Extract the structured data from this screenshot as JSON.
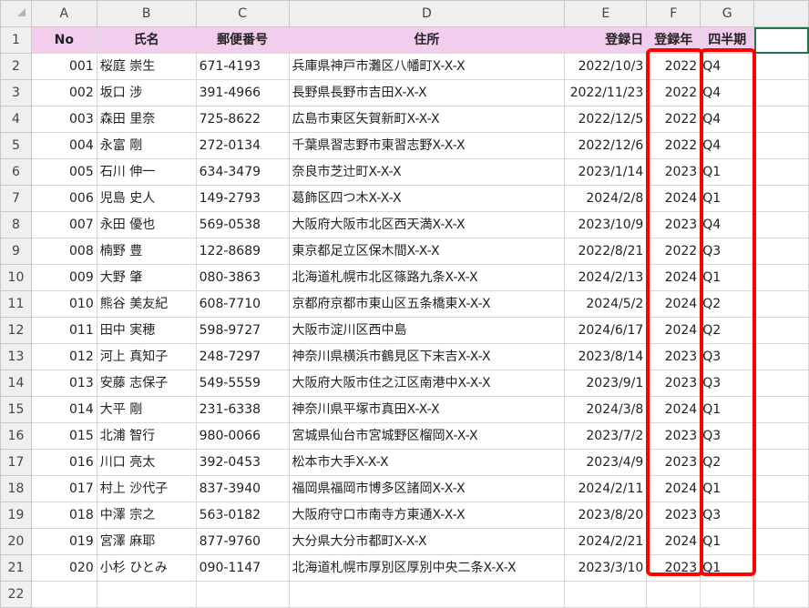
{
  "columns": [
    "A",
    "B",
    "C",
    "D",
    "E",
    "F",
    "G",
    ""
  ],
  "header": {
    "row_label": "1",
    "cells": [
      "No",
      "氏名",
      "郵便番号",
      "住所",
      "登録日",
      "登録年",
      "四半期",
      ""
    ]
  },
  "rows": [
    {
      "r": "2",
      "no": "001",
      "name": "桜庭 崇生",
      "zip": "671-4193",
      "addr": "兵庫県神戸市灘区八幡町X-X-X",
      "date": "2022/10/3",
      "year": "2022",
      "q": "Q4"
    },
    {
      "r": "3",
      "no": "002",
      "name": "坂口 涉",
      "zip": "391-4966",
      "addr": "長野県長野市吉田X-X-X",
      "date": "2022/11/23",
      "year": "2022",
      "q": "Q4"
    },
    {
      "r": "4",
      "no": "003",
      "name": "森田 里奈",
      "zip": "725-8622",
      "addr": "広島市東区矢賀新町X-X-X",
      "date": "2022/12/5",
      "year": "2022",
      "q": "Q4"
    },
    {
      "r": "5",
      "no": "004",
      "name": "永富 剛",
      "zip": "272-0134",
      "addr": "千葉県習志野市東習志野X-X-X",
      "date": "2022/12/6",
      "year": "2022",
      "q": "Q4"
    },
    {
      "r": "6",
      "no": "005",
      "name": "石川 伸一",
      "zip": "634-3479",
      "addr": "奈良市芝辻町X-X-X",
      "date": "2023/1/14",
      "year": "2023",
      "q": "Q1"
    },
    {
      "r": "7",
      "no": "006",
      "name": "児島 史人",
      "zip": "149-2793",
      "addr": "葛飾区四つ木X-X-X",
      "date": "2024/2/8",
      "year": "2024",
      "q": "Q1"
    },
    {
      "r": "8",
      "no": "007",
      "name": "永田 優也",
      "zip": "569-0538",
      "addr": "大阪府大阪市北区西天満X-X-X",
      "date": "2023/10/9",
      "year": "2023",
      "q": "Q4"
    },
    {
      "r": "9",
      "no": "008",
      "name": "楠野 豊",
      "zip": "122-8689",
      "addr": "東京都足立区保木間X-X-X",
      "date": "2022/8/21",
      "year": "2022",
      "q": "Q3"
    },
    {
      "r": "10",
      "no": "009",
      "name": "大野 肇",
      "zip": "080-3863",
      "addr": "北海道札幌市北区篠路九条X-X-X",
      "date": "2024/2/13",
      "year": "2024",
      "q": "Q1"
    },
    {
      "r": "11",
      "no": "010",
      "name": "熊谷 美友紀",
      "zip": "608-7710",
      "addr": "京都府京都市東山区五条橋東X-X-X",
      "date": "2024/5/2",
      "year": "2024",
      "q": "Q2"
    },
    {
      "r": "12",
      "no": "011",
      "name": "田中 実穂",
      "zip": "598-9727",
      "addr": "大阪市淀川区西中島",
      "date": "2024/6/17",
      "year": "2024",
      "q": "Q2"
    },
    {
      "r": "13",
      "no": "012",
      "name": "河上 真知子",
      "zip": "248-7297",
      "addr": "神奈川県横浜市鶴見区下末吉X-X-X",
      "date": "2023/8/14",
      "year": "2023",
      "q": "Q3"
    },
    {
      "r": "14",
      "no": "013",
      "name": "安藤 志保子",
      "zip": "549-5559",
      "addr": "大阪府大阪市住之江区南港中X-X-X",
      "date": "2023/9/1",
      "year": "2023",
      "q": "Q3"
    },
    {
      "r": "15",
      "no": "014",
      "name": "大平 剛",
      "zip": "231-6338",
      "addr": "神奈川県平塚市真田X-X-X",
      "date": "2024/3/8",
      "year": "2024",
      "q": "Q1"
    },
    {
      "r": "16",
      "no": "015",
      "name": "北浦 智行",
      "zip": "980-0066",
      "addr": "宮城県仙台市宮城野区榴岡X-X-X",
      "date": "2023/7/2",
      "year": "2023",
      "q": "Q3"
    },
    {
      "r": "17",
      "no": "016",
      "name": "川口 亮太",
      "zip": "392-0453",
      "addr": "松本市大手X-X-X",
      "date": "2023/4/9",
      "year": "2023",
      "q": "Q2"
    },
    {
      "r": "18",
      "no": "017",
      "name": "村上 沙代子",
      "zip": "837-3940",
      "addr": "福岡県福岡市博多区諸岡X-X-X",
      "date": "2024/2/11",
      "year": "2024",
      "q": "Q1"
    },
    {
      "r": "19",
      "no": "018",
      "name": "中澤 宗之",
      "zip": "563-0182",
      "addr": "大阪府守口市南寺方東通X-X-X",
      "date": "2023/8/20",
      "year": "2023",
      "q": "Q3"
    },
    {
      "r": "20",
      "no": "019",
      "name": "宮澤 麻耶",
      "zip": "877-9760",
      "addr": "大分県大分市都町X-X-X",
      "date": "2024/2/21",
      "year": "2024",
      "q": "Q1"
    },
    {
      "r": "21",
      "no": "020",
      "name": "小杉 ひとみ",
      "zip": "090-1147",
      "addr": "北海道札幌市厚別区厚別中央二条X-X-X",
      "date": "2023/3/10",
      "year": "2023",
      "q": "Q1"
    }
  ],
  "extra_rows": [
    "22"
  ],
  "colors": {
    "header_fill": "#f2cdee",
    "highlight": "#ff0000",
    "selection": "#217346"
  }
}
